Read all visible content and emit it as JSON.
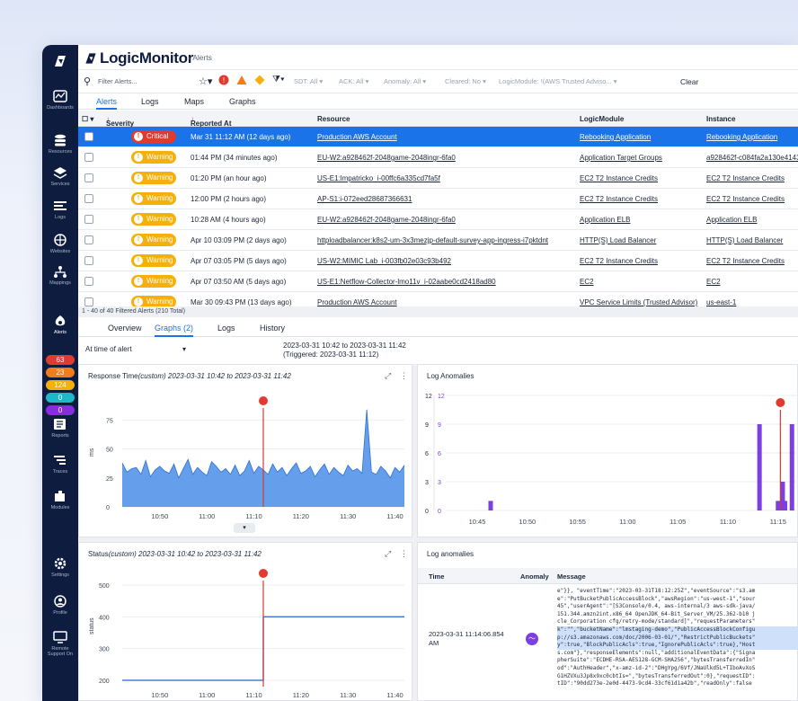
{
  "app": {
    "brand": "LogicMonitor",
    "breadcrumb": "Alerts"
  },
  "rail": {
    "items": [
      {
        "label": "Dashboards",
        "icon": "dashboard-icon"
      },
      {
        "label": "Resources",
        "icon": "resources-icon"
      },
      {
        "label": "Services",
        "icon": "services-icon"
      },
      {
        "label": "Logs",
        "icon": "logs-icon"
      },
      {
        "label": "Websites",
        "icon": "websites-icon"
      },
      {
        "label": "Mappings",
        "icon": "mappings-icon"
      },
      {
        "label": "Alerts",
        "icon": "alerts-icon"
      },
      {
        "label": "Reports",
        "icon": "reports-icon"
      },
      {
        "label": "Traces",
        "icon": "traces-icon"
      },
      {
        "label": "Modules",
        "icon": "modules-icon"
      },
      {
        "label": "Settings",
        "icon": "settings-icon"
      },
      {
        "label": "Profile",
        "icon": "profile-icon"
      },
      {
        "label": "Remote Support On",
        "icon": "remote-support-icon"
      }
    ],
    "alert_counts": [
      {
        "value": "63",
        "color": "#e03b2e"
      },
      {
        "value": "23",
        "color": "#f07c1b"
      },
      {
        "value": "124",
        "color": "#f6b00b"
      },
      {
        "value": "0",
        "color": "#1fb8c7"
      },
      {
        "value": "0",
        "color": "#8a2be2"
      }
    ]
  },
  "filters": {
    "placeholder": "Filter Alerts...",
    "sdt": "SDT: All",
    "ack": "ACK: All",
    "anomaly": "Anomaly: All",
    "cleared": "Cleared: No",
    "logicmodule": "LogicModule: !(AWS Trusted Adviso...",
    "clear": "Clear"
  },
  "tabs": [
    "Alerts",
    "Logs",
    "Maps",
    "Graphs"
  ],
  "table": {
    "headers": {
      "severity": "Severity",
      "reported": "Reported At",
      "resource": "Resource",
      "logicmodule": "LogicModule",
      "instance": "Instance"
    },
    "rows": [
      {
        "severity": "Critical",
        "reported": "Mar 31 11:12 AM (12 days ago)",
        "resource": "Production AWS Account",
        "logicmodule": "Rebooking Application",
        "instance": "Rebooking Application"
      },
      {
        "severity": "Warning",
        "reported": "01:44 PM (34 minutes ago)",
        "resource": "EU-W2:a928462f-2048game-2048ingr-6fa0",
        "logicmodule": "Application Target Groups",
        "instance": "a928462f-c084fa2a130e4143"
      },
      {
        "severity": "Warning",
        "reported": "01:20 PM (an hour ago)",
        "resource": "US-E1:lmpatricko_i-00ffc6a335cd7fa5f",
        "logicmodule": "EC2 T2 Instance Credits",
        "instance": "EC2 T2 Instance Credits"
      },
      {
        "severity": "Warning",
        "reported": "12:00 PM (2 hours ago)",
        "resource": "AP-S1:i-072eed28687366631",
        "logicmodule": "EC2 T2 Instance Credits",
        "instance": "EC2 T2 Instance Credits"
      },
      {
        "severity": "Warning",
        "reported": "10:28 AM (4 hours ago)",
        "resource": "EU-W2:a928462f-2048game-2048ingr-6fa0",
        "logicmodule": "Application ELB",
        "instance": "Application ELB"
      },
      {
        "severity": "Warning",
        "reported": "Apr 10 03:09 PM (2 days ago)",
        "resource": "httploadbalancer:k8s2-um-3x3mezjp-default-survey-app-ingress-i7pktdnt",
        "logicmodule": "HTTP(S) Load Balancer",
        "instance": "HTTP(S) Load Balancer"
      },
      {
        "severity": "Warning",
        "reported": "Apr 07 03:05 PM (5 days ago)",
        "resource": "US-W2:MIMIC Lab_i-003fb02e03c93b492",
        "logicmodule": "EC2 T2 Instance Credits",
        "instance": "EC2 T2 Instance Credits"
      },
      {
        "severity": "Warning",
        "reported": "Apr 07 03:50 AM (5 days ago)",
        "resource": "US-E1:Netflow-Collector-lmo11v_i-02aabe0cd2418ad80",
        "logicmodule": "EC2",
        "instance": "EC2"
      },
      {
        "severity": "Warning",
        "reported": "Mar 30 09:43 PM (13 days ago)",
        "resource": "Production AWS Account",
        "logicmodule": "VPC Service Limits (Trusted Advisor)",
        "instance": "us-east-1"
      }
    ],
    "count": "1 - 40 of 40 Filtered Alerts (210 Total)"
  },
  "detail_tabs": [
    "Overview",
    "Graphs (2)",
    "Logs",
    "History"
  ],
  "time_select": "At time of alert",
  "range": {
    "line1": "2023-03-31 10:42 to 2023-03-31 11:42",
    "line2": "(Triggered: 2023-03-31 11:12)"
  },
  "panels": {
    "response": {
      "title": "Response Time",
      "qual": "(custom) 2023-03-31 10:42 to 2023-03-31 11:42",
      "ylabel": "ms"
    },
    "anomalies": {
      "title": "Log Anomalies"
    },
    "status": {
      "title": "Status",
      "qual": "(custom) 2023-03-31 10:42 to 2023-03-31 11:42",
      "ylabel": "status"
    },
    "logs": {
      "title": "Log anomalies",
      "col_time": "Time",
      "col_anomaly": "Anomaly",
      "col_message": "Message",
      "row_time": "2023-03-31 11:14:06.854 AM"
    }
  },
  "chart_data": [
    {
      "type": "area",
      "title": "Response Time(custom) 2023-03-31 10:42 to 2023-03-31 11:42",
      "ylabel": "ms",
      "ylim": [
        0,
        90
      ],
      "yticks": [
        "0",
        "25",
        "50",
        "75"
      ],
      "xticks": [
        "10:50",
        "11:00",
        "11:10",
        "11:20",
        "11:30",
        "11:40"
      ],
      "x_range": [
        0,
        60
      ],
      "x": [
        0,
        1,
        2,
        3,
        4,
        5,
        6,
        7,
        8,
        9,
        10,
        11,
        12,
        13,
        14,
        15,
        16,
        17,
        18,
        19,
        20,
        21,
        22,
        23,
        24,
        25,
        26,
        27,
        28,
        29,
        30,
        31,
        32,
        33,
        34,
        35,
        36,
        37,
        38,
        39,
        40,
        41,
        42,
        43,
        44,
        45,
        46,
        47,
        48,
        49,
        50,
        51,
        52,
        53,
        54,
        55,
        56,
        57,
        58,
        59,
        60
      ],
      "values": [
        38,
        30,
        33,
        34,
        28,
        40,
        26,
        32,
        35,
        31,
        29,
        37,
        25,
        33,
        41,
        28,
        34,
        30,
        27,
        39,
        35,
        30,
        33,
        28,
        36,
        27,
        31,
        40,
        29,
        35,
        32,
        28,
        37,
        30,
        34,
        27,
        33,
        38,
        29,
        31,
        35,
        26,
        32,
        37,
        28,
        34,
        30,
        27,
        36,
        31,
        33,
        29,
        84,
        30,
        28,
        35,
        31,
        25,
        34,
        30,
        36
      ],
      "marker_x": 30,
      "color": "#4a8ee8"
    },
    {
      "type": "bar",
      "title": "Log Anomalies",
      "ylim": [
        0,
        12
      ],
      "yticks": [
        "0",
        "3",
        "6",
        "9",
        "12"
      ],
      "xticks": [
        "10:45",
        "10:50",
        "10:55",
        "11:00",
        "11:05",
        "11:10",
        "11:15"
      ],
      "x_range": [
        10.42,
        11.18
      ],
      "bars": [
        {
          "x": 10.515,
          "value": 1
        },
        {
          "x": 11.095,
          "value": 9
        },
        {
          "x": 11.135,
          "value": 1
        },
        {
          "x": 11.145,
          "value": 3
        },
        {
          "x": 11.15,
          "value": 1
        },
        {
          "x": 11.165,
          "value": 9
        }
      ],
      "marker_x": 11.14,
      "color": "#7b3fe4"
    },
    {
      "type": "line",
      "title": "Status(custom) 2023-03-31 10:42 to 2023-03-31 11:42",
      "ylabel": "status",
      "ylim": [
        180,
        520
      ],
      "yticks": [
        "200",
        "300",
        "400",
        "500"
      ],
      "xticks": [
        "10:50",
        "11:00",
        "11:10",
        "11:20",
        "11:30",
        "11:40"
      ],
      "x_range": [
        0,
        60
      ],
      "x": [
        0,
        30,
        30.01,
        60
      ],
      "values": [
        200,
        200,
        400,
        400
      ],
      "marker_x": 30,
      "color": "#3d6fd8"
    }
  ],
  "log_message": [
    "e\"}}, \"eventTime\":\"2023-03-31T18:12:25Z\",\"eventSource\":\"s3.am",
    "e\":\"PutBucketPublicAccessBlock\",\"awsRegion\":\"us-west-1\",\"sour",
    "45\",\"userAgent\":\"[S3Console/0.4, aws-internal/3 aws-sdk-java/",
    "151.344.amzn2int.x86_64 OpenJDK_64-Bit_Server_VM/25.362-b10 j",
    "cle_Corporation cfg/retry-mode/standard]\",\"requestParameters\"",
    "k\":\"\",\"bucketName\":\"lmstaging-demo\",\"PublicAccessBlockConfigu",
    "p://s3.amazonaws.com/doc/2006-03-01/\",\"RestrictPublicBuckets\"",
    "y\":true,\"BlockPublicAcls\":true,\"IgnorePublicAcls\":true},\"Host",
    "s.com\"},\"responseElements\":null,\"additionalEventData\":{\"Signa",
    "pherSuite\":\"ECDHE-RSA-AES128-GCM-SHA256\",\"bytesTransferredIn\"",
    "od\":\"AuthHeader\",\"x-amz-id-2\":\"DHgYpg/6Vf/JNaUlkd5L+TIboAvXoS",
    "G1HZVXu3Jp8x9xc0cbtIs=\",\"bytesTransferredOut\":0},\"requestID\":",
    "tID\":\"90dd273e-2e0d-4473-9cd4-33cf61d1a42b\",\"readOnly\":false"
  ]
}
